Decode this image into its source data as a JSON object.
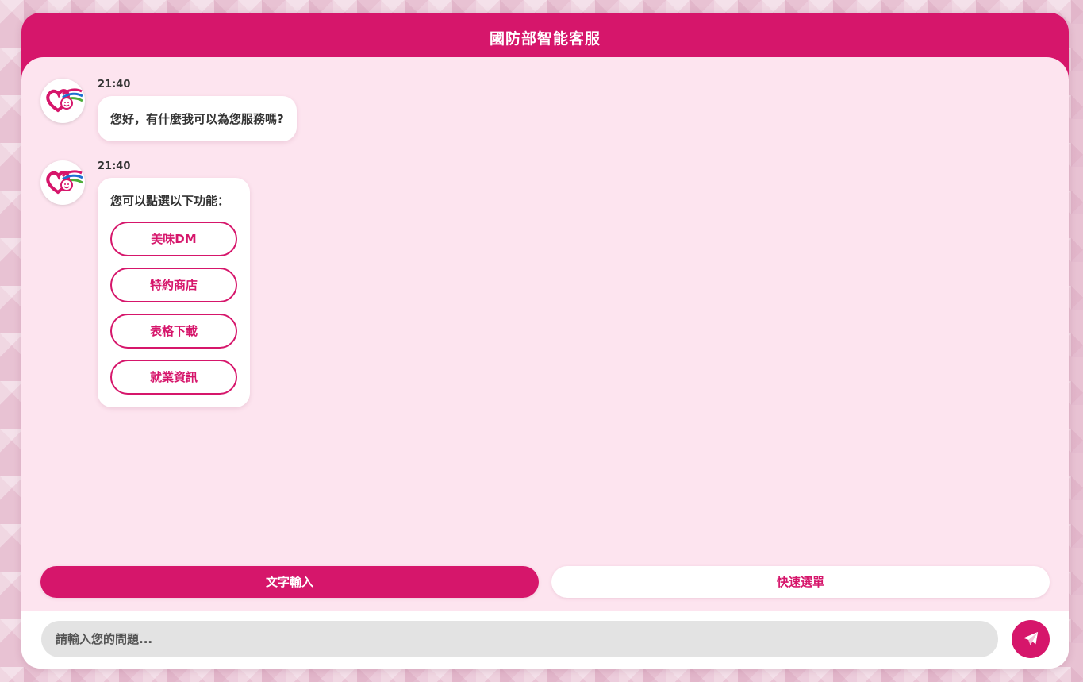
{
  "app": {
    "title": "國防部智能客服"
  },
  "colors": {
    "accent": "#d6166b",
    "chat_bg": "#fde4ef",
    "input_bg": "#e3e3e3"
  },
  "messages": [
    {
      "time": "21:40",
      "text": "您好，有什麼我可以為您服務嗎?",
      "avatar_icon": "heart-logo-icon"
    },
    {
      "time": "21:40",
      "text": "您可以點選以下功能：",
      "avatar_icon": "heart-logo-icon",
      "options": [
        "美味DM",
        "特約商店",
        "表格下載",
        "就業資訊"
      ]
    }
  ],
  "mode_tabs": {
    "text_input": "文字輸入",
    "quick_menu": "快速選單"
  },
  "input": {
    "placeholder": "請輸入您的問題..."
  },
  "send": {
    "icon": "paper-plane-icon"
  }
}
